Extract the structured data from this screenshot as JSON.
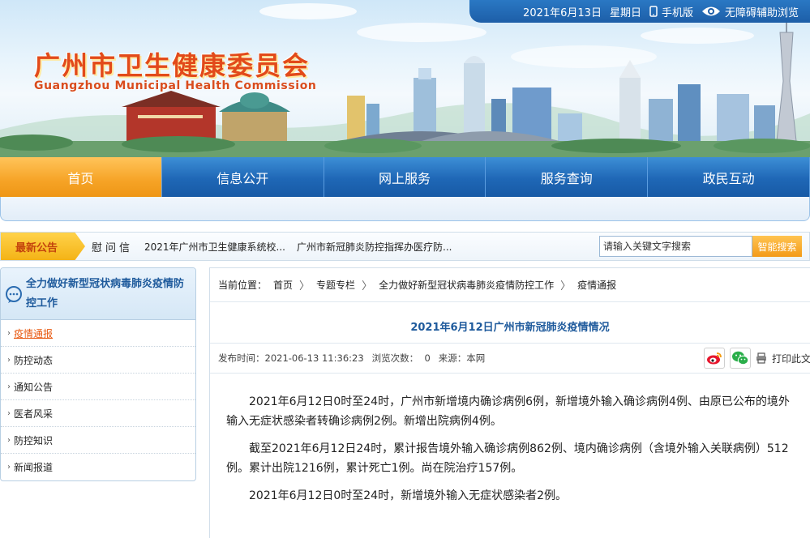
{
  "topbar": {
    "date": "2021年6月13日",
    "weekday": "星期日",
    "mobile_label": "手机版",
    "accessibility_label": "无障碍辅助浏览"
  },
  "brand": {
    "name_cn": "广州市卫生健康委员会",
    "name_en": "Guangzhou Municipal Health Commission"
  },
  "nav": {
    "items": [
      {
        "label": "首页",
        "active": true
      },
      {
        "label": "信息公开",
        "active": false
      },
      {
        "label": "网上服务",
        "active": false
      },
      {
        "label": "服务查询",
        "active": false
      },
      {
        "label": "政民互动",
        "active": false
      }
    ]
  },
  "notice": {
    "tag": "最新公告",
    "lead": "慰问信",
    "items": [
      "2021年广州市卫生健康系统校...",
      "广州市新冠肺炎防控指挥办医疗防..."
    ]
  },
  "search": {
    "placeholder": "请输入关键文字搜索",
    "button": "智能搜索"
  },
  "sidebar": {
    "title": "全力做好新型冠状病毒肺炎疫情防控工作",
    "items": [
      {
        "label": "疫情通报",
        "active": true
      },
      {
        "label": "防控动态",
        "active": false
      },
      {
        "label": "通知公告",
        "active": false
      },
      {
        "label": "医者风采",
        "active": false
      },
      {
        "label": "防控知识",
        "active": false
      },
      {
        "label": "新闻报道",
        "active": false
      }
    ]
  },
  "breadcrumb": {
    "prefix": "当前位置：",
    "items": [
      "首页",
      "专题专栏",
      "全力做好新型冠状病毒肺炎疫情防控工作",
      "疫情通报"
    ],
    "separator": "〉"
  },
  "article": {
    "title": "2021年6月12日广州市新冠肺炎疫情情况",
    "publish_label": "发布时间：",
    "publish_time": "2021-06-13 11:36:23",
    "views_label": "浏览次数：",
    "views": "0",
    "source_label": "来源：",
    "source": "本网",
    "print_label": "打印此文",
    "paragraphs": [
      "2021年6月12日0时至24时，广州市新增境内确诊病例6例，新增境外输入确诊病例4例、由原已公布的境外输入无症状感染者转确诊病例2例。新增出院病例4例。",
      "截至2021年6月12日24时，累计报告境外输入确诊病例862例、境内确诊病例（含境外输入关联病例）512例。累计出院1216例，累计死亡1例。尚在院治疗157例。",
      "2021年6月12日0时至24时，新增境外输入无症状感染者2例。"
    ]
  },
  "colors": {
    "brand_blue": "#1f67b6",
    "accent_orange": "#f6a326",
    "title_blue": "#1e5a9c",
    "logo_red": "#e24a1a"
  }
}
